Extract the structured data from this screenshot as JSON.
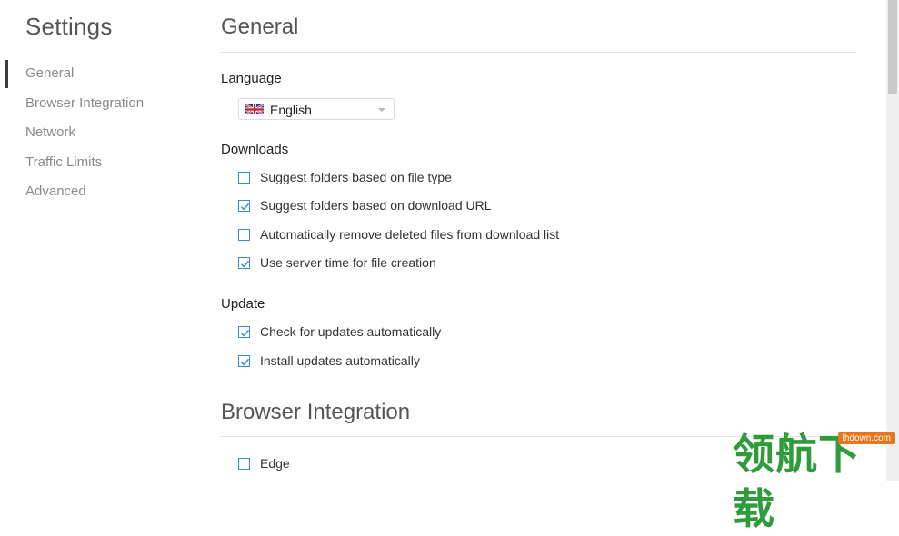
{
  "sidebar": {
    "title": "Settings",
    "items": [
      {
        "label": "General",
        "active": true
      },
      {
        "label": "Browser Integration",
        "active": false
      },
      {
        "label": "Network",
        "active": false
      },
      {
        "label": "Traffic Limits",
        "active": false
      },
      {
        "label": "Advanced",
        "active": false
      }
    ]
  },
  "general": {
    "title": "General",
    "language": {
      "label": "Language",
      "selected": "English",
      "flag_icon": "uk-flag-icon"
    },
    "downloads": {
      "label": "Downloads",
      "options": [
        {
          "label": "Suggest folders based on file type",
          "checked": false
        },
        {
          "label": "Suggest folders based on download URL",
          "checked": true
        },
        {
          "label": "Automatically remove deleted files from download list",
          "checked": false
        },
        {
          "label": "Use server time for file creation",
          "checked": true
        }
      ]
    },
    "update": {
      "label": "Update",
      "options": [
        {
          "label": "Check for updates automatically",
          "checked": true
        },
        {
          "label": "Install updates automatically",
          "checked": true
        }
      ]
    }
  },
  "browser_integration": {
    "title": "Browser Integration",
    "options": [
      {
        "label": "Edge",
        "checked": false
      }
    ]
  },
  "watermark": {
    "text": "领航下载",
    "tag": "lhdown.com"
  },
  "colors": {
    "accent": "#3a8fd4",
    "active_indicator": "#3d3d3d",
    "watermark_green": "#2f9b3a",
    "watermark_orange": "#e8761c"
  }
}
